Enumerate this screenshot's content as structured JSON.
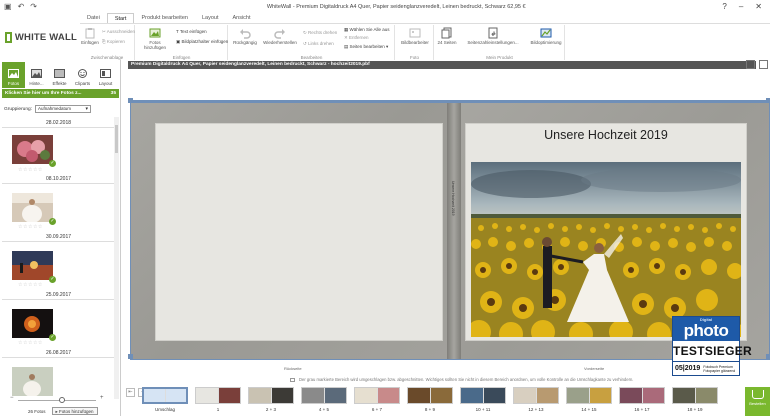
{
  "window": {
    "title": "WhiteWall - Premium Digitaldruck A4 Quer, Papier seidenglanzveredelt, Leinen bedruckt, Schwarz 62,95 €",
    "help": "?",
    "minimize": "–",
    "close": "✕"
  },
  "ribbon_tabs": [
    "Datei",
    "Start",
    "Produkt bearbeiten",
    "Layout",
    "Ansicht"
  ],
  "logo_text": "WHITE WALL",
  "ribbon": {
    "clipboard": {
      "cut": "Ausschneiden",
      "copy": "Kopieren",
      "paste": "Einfügen",
      "label": "Zwischenablage"
    },
    "insert": {
      "photos": "Fotos hinzufügen",
      "text": "Text einfügen",
      "placeholder": "Bildplatzhalter einfügen",
      "label": "Einfügen"
    },
    "edit": {
      "undo": "Rückgängig",
      "redo": "Wiederherstellen",
      "rotate_right": "Rechts drehen",
      "rotate_left": "Links drehen",
      "select_all": "Wählen Sie Alle aus",
      "remove": "Entfernen",
      "page_edit": "Seiten bearbeiten",
      "label": "Bearbeiten"
    },
    "photo": {
      "editor": "Bildbearbeiter",
      "label": "Foto"
    },
    "product": {
      "pages": "24 Seiten",
      "page_settings": "Seitenzahleinstellungen...",
      "optimize": "Bildoptimierung",
      "label": "Mein Produkt"
    }
  },
  "left_panel": {
    "tabs": [
      "Fotos",
      "Hinte...",
      "Effekte",
      "Cliparts",
      "Layout"
    ],
    "banner": "Klicken Sie hier um Ihre Fotos z...",
    "banner_count": "35",
    "grouping_label": "Gruppierung:",
    "grouping_value": "Aufnahmedatum",
    "dates": [
      "28.02.2018",
      "08.10.2017",
      "30.09.2017",
      "25.09.2017",
      "26.08.2017"
    ],
    "stars": "☆☆☆☆☆",
    "footer_count": "26 Fotos",
    "footer_button": "Fotos hinzufügen"
  },
  "main": {
    "caption": "Premium Digitaldruck A4 Quer, Papier seidenglanzveredelt, Leinen bedruckt, Schwarz - hochzeit2019.pbf",
    "book_title": "Unsere Hochzeit 2019",
    "spine_text": "Unsere Hochzeit 2019",
    "back_label": "Rückseite",
    "front_label": "Vorderseite",
    "hint": "Der grau markierte Bereich wird umgeschlagen bzw. abgeschnitten. Wichtiges sollten Sie nicht in diesem Bereich anordnen, um volle Kontrolle an die Umschlagkante zu verhindern."
  },
  "badge": {
    "magazine_small": "Digital",
    "magazine": "photo",
    "award": "TESTSIEGER",
    "issue": "05|2019",
    "desc": "Fotobuch Premium Fotopapier glänzend"
  },
  "filmstrip": {
    "nav_left": "⇤",
    "nav_prev": "◂",
    "items": [
      "Umschlag",
      "1",
      "2 + 3",
      "4 + 5",
      "6 + 7",
      "8 + 9",
      "10 + 11",
      "12 + 13",
      "14 + 15",
      "16 + 17",
      "18 + 19"
    ]
  },
  "order_label": "Bestellen"
}
